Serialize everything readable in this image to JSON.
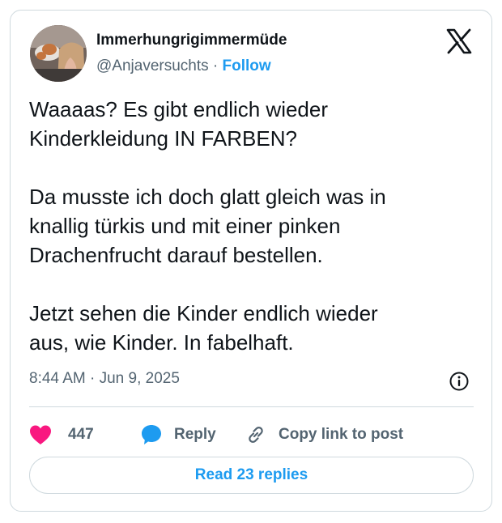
{
  "author": {
    "display_name": "Immerhungrigimmermüde",
    "handle": "@Anjaversuchts",
    "separator": "·",
    "follow_label": "Follow"
  },
  "post": {
    "text": "Waaaas? Es gibt endlich wieder\nKinderkleidung IN FARBEN?\n\nDa musste ich doch glatt gleich was in\nknallig türkis und mit einer pinken\nDrachenfrucht darauf bestellen.\n\nJetzt sehen die Kinder endlich wieder\naus, wie Kinder. In fabelhaft.",
    "timestamp": "8:44 AM · Jun 9, 2025"
  },
  "actions": {
    "like_count": "447",
    "reply_label": "Reply",
    "copy_label": "Copy link to post"
  },
  "footer": {
    "read_replies_label": "Read 23 replies"
  },
  "colors": {
    "accent": "#1d9bf0",
    "like": "#f91880",
    "secondary_text": "#536471",
    "border": "#cfd9de"
  },
  "icons": {
    "brand": "x-logo-icon",
    "info": "info-icon",
    "like": "heart-icon",
    "reply": "speech-bubble-icon",
    "copy": "link-icon"
  }
}
